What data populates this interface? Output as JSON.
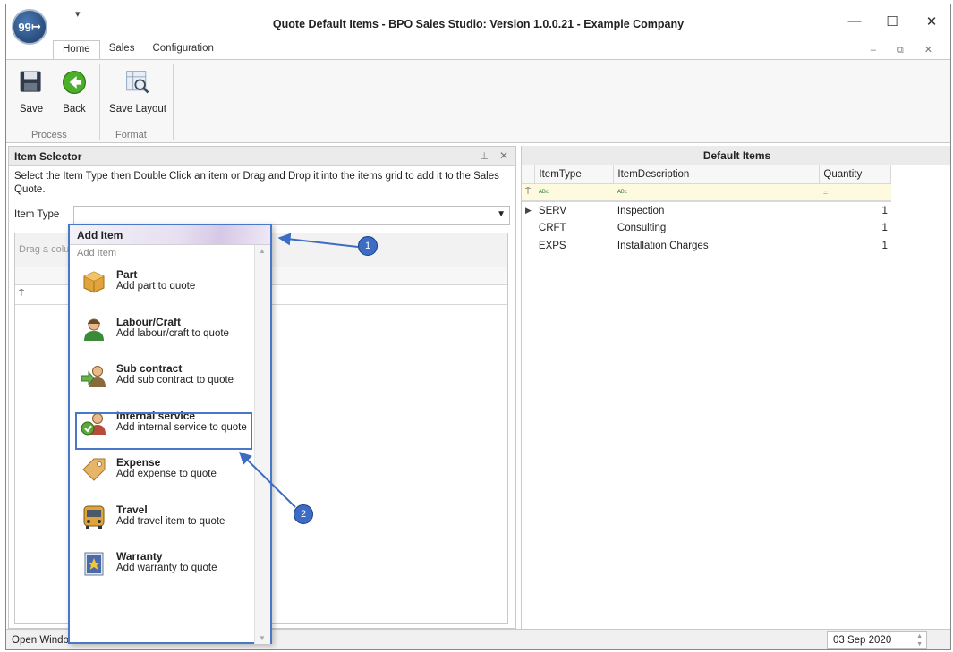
{
  "window": {
    "title": "Quote Default Items - BPO Sales Studio: Version 1.0.0.21 - Example Company",
    "logo_text": "99",
    "minimize": "—",
    "maximize": "☐",
    "close": "✕"
  },
  "ribbon": {
    "tabs": [
      {
        "label": "Home",
        "active": true
      },
      {
        "label": "Sales",
        "active": false
      },
      {
        "label": "Configuration",
        "active": false
      }
    ],
    "buttons": {
      "save": "Save",
      "back": "Back",
      "save_layout": "Save Layout"
    },
    "groups": {
      "process": "Process",
      "format": "Format"
    }
  },
  "item_selector": {
    "title": "Item Selector",
    "instructions": "Select the Item Type then Double Click an item or Drag and Drop it into the items grid to add it to the Sales Quote.",
    "item_type_label": "Item Type",
    "item_type_value": "",
    "group_panel_text": "Drag a colu"
  },
  "add_item_popup": {
    "title": "Add Item",
    "subtitle": "Add Item",
    "items": [
      {
        "title": "Part",
        "desc": "Add part to quote",
        "icon": "box-icon"
      },
      {
        "title": "Labour/Craft",
        "desc": "Add labour/craft to quote",
        "icon": "worker-icon"
      },
      {
        "title": "Sub contract",
        "desc": "Add sub contract to quote",
        "icon": "subcontract-icon"
      },
      {
        "title": "Internal service",
        "desc": "Add internal service to quote",
        "icon": "internal-service-icon"
      },
      {
        "title": "Expense",
        "desc": "Add expense to quote",
        "icon": "tag-icon"
      },
      {
        "title": "Travel",
        "desc": "Add travel item to quote",
        "icon": "bus-icon"
      },
      {
        "title": "Warranty",
        "desc": "Add warranty to quote",
        "icon": "warranty-icon"
      }
    ]
  },
  "callouts": [
    "1",
    "2"
  ],
  "default_items": {
    "title": "Default Items",
    "columns": [
      "ItemType",
      "ItemDescription",
      "Quantity"
    ],
    "rows": [
      {
        "type": "SERV",
        "description": "Inspection",
        "quantity": "1"
      },
      {
        "type": "CRFT",
        "description": "Consulting",
        "quantity": "1"
      },
      {
        "type": "EXPS",
        "description": "Installation Charges",
        "quantity": "1"
      }
    ]
  },
  "statusbar": {
    "text": "Open Windo",
    "date": "03 Sep 2020"
  },
  "colors": {
    "accent": "#4a78c8",
    "filter_row": "#fdfae0"
  }
}
